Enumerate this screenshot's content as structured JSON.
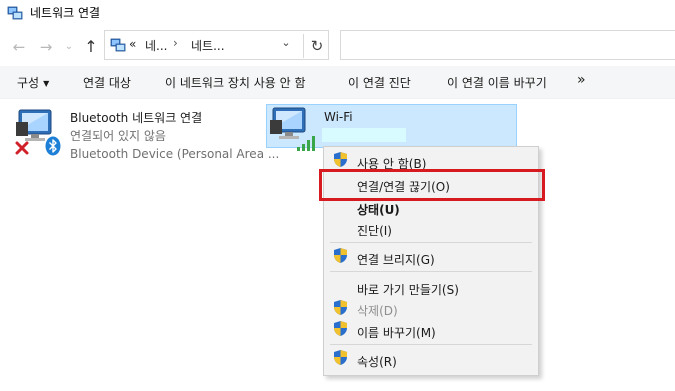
{
  "window": {
    "title": "네트워크 연결"
  },
  "nav": {
    "back_icon": "arrow-left",
    "forward_icon": "arrow-right",
    "recent_icon": "chevron-down",
    "up_icon": "arrow-up",
    "breadcrumb_prefix": "«",
    "breadcrumb": [
      "네...",
      "네트..."
    ],
    "breadcrumb_sep": "›",
    "dropdown_glyph": "⌄",
    "refresh_glyph": "↻"
  },
  "toolbar": {
    "items": [
      {
        "label": "구성"
      },
      {
        "label": "연결 대상"
      },
      {
        "label": "이 네트워크 장치 사용 안 함"
      },
      {
        "label": "이 연결 진단"
      },
      {
        "label": "이 연결 이름 바꾸기"
      },
      {
        "label": "»"
      }
    ],
    "caret": "▼"
  },
  "connections": [
    {
      "name": "Bluetooth 네트워크 연결",
      "status": "연결되어 있지 않음",
      "device": "Bluetooth Device (Personal Area ..."
    },
    {
      "name": "Wi-Fi",
      "status": ""
    }
  ],
  "context_menu": {
    "items": [
      {
        "label": "사용 안 함(B)",
        "shield": true
      },
      {
        "label": "연결/연결 끊기(O)",
        "shield": false
      },
      {
        "label": "상태(U)",
        "shield": false,
        "bold": true
      },
      {
        "label": "진단(I)",
        "shield": false
      },
      {
        "label": "연결 브리지(G)",
        "shield": true
      },
      {
        "label": "바로 가기 만들기(S)",
        "shield": false
      },
      {
        "label": "삭제(D)",
        "shield": true,
        "disabled": true
      },
      {
        "label": "이름 바꾸기(M)",
        "shield": true
      },
      {
        "label": "속성(R)",
        "shield": true
      }
    ],
    "highlighted_item": "연결/연결 끊기(O)",
    "highlight_color": "#d71920"
  },
  "colors": {
    "selection_bg": "#cce8ff",
    "selection_border": "#99d1ff",
    "toolbar_bg": "#f5f6f7",
    "menu_bg": "#f2f2f2"
  }
}
